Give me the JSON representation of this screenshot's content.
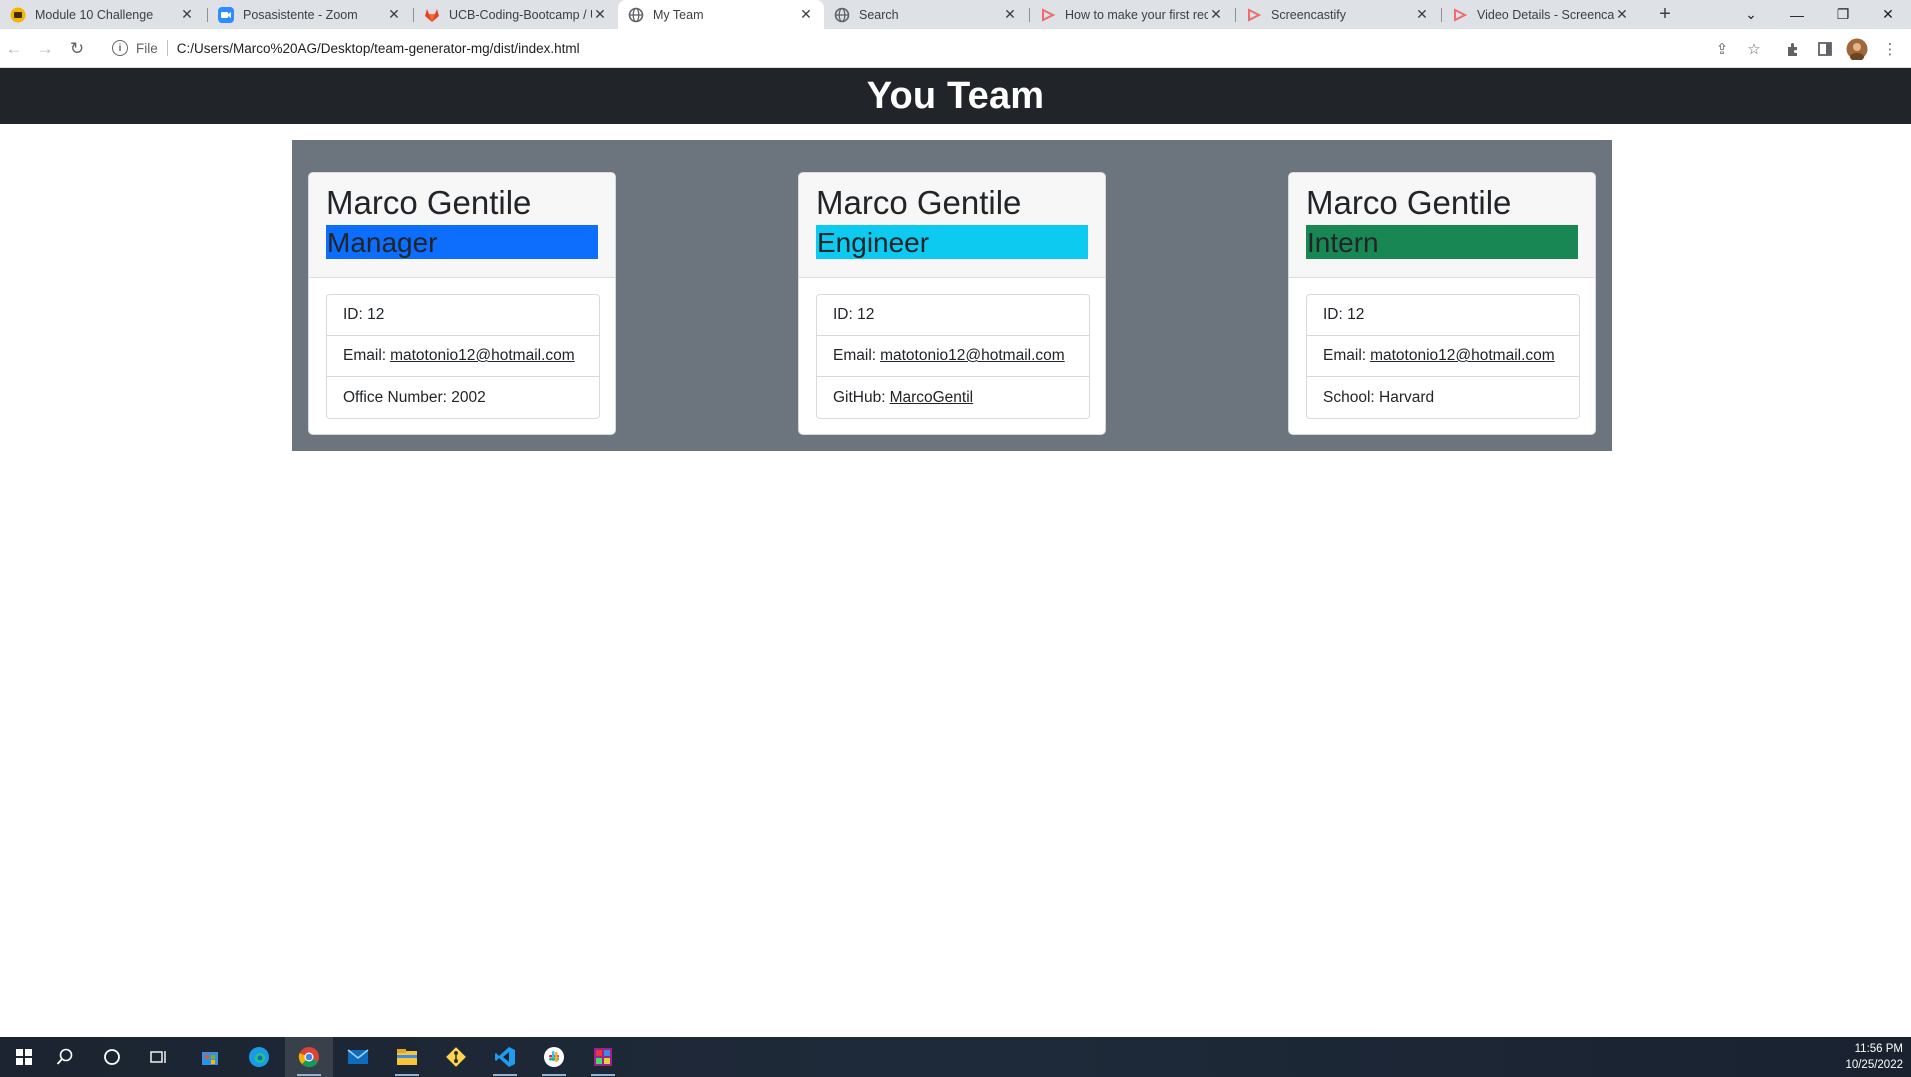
{
  "browser": {
    "tabs": [
      {
        "title": "Module 10 Challenge",
        "icon": "bootcamp-favicon",
        "active": false
      },
      {
        "title": "Posasistente - Zoom",
        "icon": "zoom-favicon",
        "active": false
      },
      {
        "title": "UCB-Coding-Bootcamp / U",
        "icon": "gitlab-favicon",
        "active": false
      },
      {
        "title": "My Team",
        "icon": "globe-favicon",
        "active": true
      },
      {
        "title": "Search",
        "icon": "globe-favicon",
        "active": false
      },
      {
        "title": "How to make your first rec",
        "icon": "screencastify-favicon",
        "active": false
      },
      {
        "title": "Screencastify",
        "icon": "screencastify-favicon",
        "active": false
      },
      {
        "title": "Video Details - Screencast",
        "icon": "screencastify-favicon",
        "active": false
      }
    ],
    "address": {
      "scheme_label": "File",
      "url": "C:/Users/Marco%20AG/Desktop/team-generator-mg/dist/index.html"
    }
  },
  "page": {
    "header_title": "You Team",
    "cards": [
      {
        "name": "Marco Gentile",
        "role": "Manager",
        "id_text": "ID: 12",
        "email_label": "Email:",
        "email": "matotonio12@hotmail.com",
        "extra_label": "Office Number: 2002",
        "extra_link": ""
      },
      {
        "name": "Marco Gentile",
        "role": "Engineer",
        "id_text": "ID: 12",
        "email_label": "Email:",
        "email": "matotonio12@hotmail.com",
        "extra_label": "GitHub:",
        "extra_link": "MarcoGentil"
      },
      {
        "name": "Marco Gentile",
        "role": "Intern",
        "id_text": "ID: 12",
        "email_label": "Email:",
        "email": "matotonio12@hotmail.com",
        "extra_label": "School: Harvard",
        "extra_link": ""
      }
    ]
  },
  "colors": {
    "header_bg": "#212529",
    "container_bg": "#6c757d",
    "manager": "#0d6efd",
    "engineer": "#0dcaf0",
    "intern": "#198754"
  },
  "taskbar": {
    "time": "11:56 PM",
    "date": "10/25/2022",
    "apps": [
      "start-icon",
      "search-icon",
      "cortana-icon",
      "task-view-icon",
      "store-icon",
      "edge-icon",
      "chrome-icon",
      "mail-icon",
      "file-explorer-icon",
      "git-icon",
      "vscode-icon",
      "slack-icon",
      "winrar-icon"
    ]
  }
}
